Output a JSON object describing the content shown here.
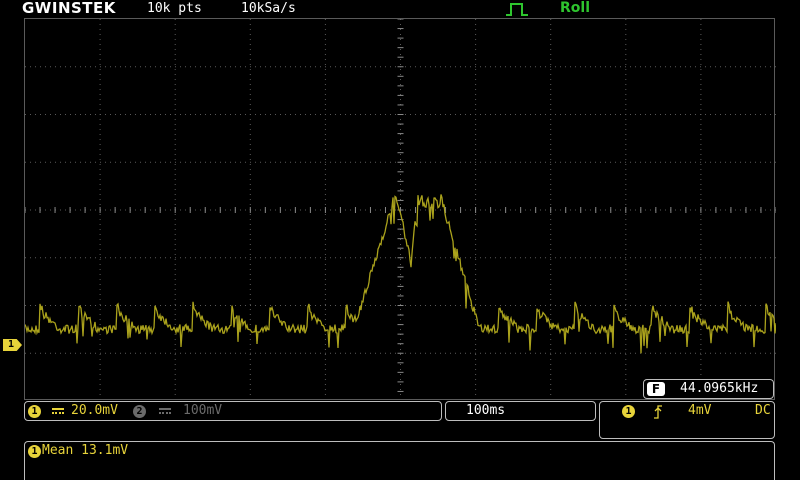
{
  "header": {
    "brand": "GWINSTEK",
    "record_length": "10k pts",
    "sample_rate": "10kSa/s",
    "trigger_icon": "edge-trigger-icon",
    "acquire_mode": "Roll"
  },
  "channel_marker": {
    "label": "1",
    "color": "#e7d33a"
  },
  "frequency": {
    "badge": "F",
    "value": "44.0965kHz"
  },
  "vertical": {
    "ch1": {
      "number": "1",
      "scale": "20.0mV",
      "color": "#e7d33a"
    },
    "ch2": {
      "number": "2",
      "scale": "100mV",
      "color": "#6a6a6a"
    }
  },
  "timebase": {
    "scale": "100ms"
  },
  "trigger": {
    "source": "1",
    "slope_icon": "rising-edge-icon",
    "level": "4mV",
    "coupling": "DC"
  },
  "measurement": {
    "channel": "1",
    "label": "Mean 13.1mV"
  },
  "colors": {
    "ch1": "#e7d33a",
    "trace": "#aaa21c",
    "roll_mode": "#2ec52e",
    "grid": "#5a5a5a"
  }
}
